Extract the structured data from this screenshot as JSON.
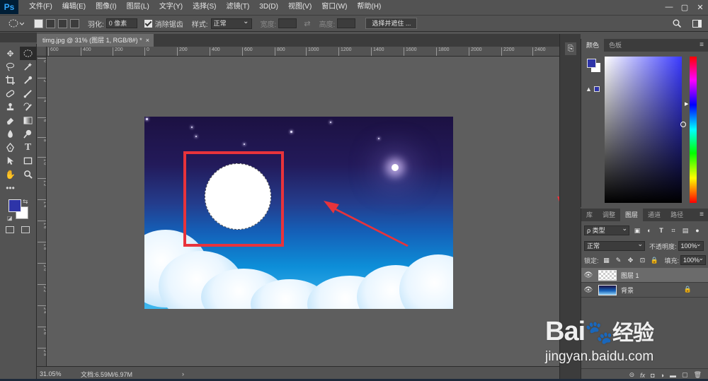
{
  "app": {
    "logo": "Ps",
    "menus": [
      "文件(F)",
      "编辑(E)",
      "图像(I)",
      "图层(L)",
      "文字(Y)",
      "选择(S)",
      "滤镜(T)",
      "3D(D)",
      "视图(V)",
      "窗口(W)",
      "帮助(H)"
    ],
    "window_controls": [
      "—",
      "▢",
      "✕"
    ]
  },
  "options": {
    "feather_label": "羽化:",
    "feather_value": "0 像素",
    "antialias_label": "消除锯齿",
    "style_label": "样式:",
    "style_value": "正常",
    "width_label": "宽度:",
    "height_label": "高度:",
    "select_mask_button": "选择并遮住 ..."
  },
  "document": {
    "tab_title": "timg.jpg @ 31% (图层 1, RGB/8#) *",
    "tab_close": "×",
    "zoom": "31.05%",
    "doc_info": "文档:6.59M/6.97M",
    "status_chevron": "›",
    "ruler_h": [
      "600",
      "400",
      "200",
      "0",
      "200",
      "400",
      "600",
      "800",
      "1000",
      "1200",
      "1400",
      "1600",
      "1800",
      "2000",
      "2200",
      "2400"
    ],
    "ruler_v": [
      "0",
      "2",
      "4",
      "6",
      "8",
      "1 0",
      "1 2",
      "1 4",
      "1 6",
      "1 8",
      "2 0",
      "2 2",
      "2 4",
      "2 6",
      "2 8"
    ]
  },
  "color_panel": {
    "tabs": [
      "颜色",
      "色板"
    ],
    "menu_icon": "≡",
    "warning_icon": "▲",
    "fg_color": "#2e34a8",
    "bg_color": "#ffffff"
  },
  "layers_panel": {
    "tabs": [
      "库",
      "调整",
      "图层",
      "通道",
      "路径"
    ],
    "filter_label": "ρ 类型",
    "blend_mode": "正常",
    "opacity_label": "不透明度:",
    "opacity_value": "100%",
    "lock_label": "锁定:",
    "fill_label": "填充:",
    "fill_value": "100%",
    "layers": [
      {
        "name": "图层 1",
        "selected": true
      },
      {
        "name": "背景",
        "selected": false,
        "locked": true
      }
    ],
    "footer_icons": [
      "⊝",
      "fx",
      "◘",
      "◑",
      "▬",
      "▢",
      "🗑"
    ]
  },
  "watermark": {
    "brand": "Bai",
    "brand2": "经验",
    "url": "jingyan.baidu.com"
  }
}
